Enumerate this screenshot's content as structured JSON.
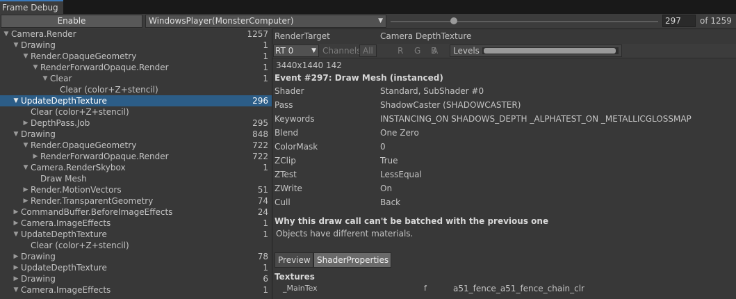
{
  "window": {
    "tab_title": "Frame Debug"
  },
  "toolbar": {
    "enable_label": "Enable",
    "player": "WindowsPlayer(MonsterComputer)",
    "event_index": "297",
    "event_total": "of 1259",
    "slider_fraction": 0.236
  },
  "tree": {
    "rows": [
      {
        "label": "Camera.Render",
        "count": "1257",
        "arrow": "▼",
        "indent": 0
      },
      {
        "label": "Drawing",
        "count": "1",
        "arrow": "▼",
        "indent": 1
      },
      {
        "label": "Render.OpaqueGeometry",
        "count": "1",
        "arrow": "▼",
        "indent": 2
      },
      {
        "label": "RenderForwardOpaque.Render",
        "count": "1",
        "arrow": "▼",
        "indent": 3
      },
      {
        "label": "Clear",
        "count": "1",
        "arrow": "▼",
        "indent": 4
      },
      {
        "label": "Clear (color+Z+stencil)",
        "count": "",
        "arrow": "",
        "indent": 5
      },
      {
        "label": "UpdateDepthTexture",
        "count": "296",
        "arrow": "▼",
        "indent": 1,
        "selected": true
      },
      {
        "label": "Clear (color+Z+stencil)",
        "count": "",
        "arrow": "",
        "indent": 2
      },
      {
        "label": "DepthPass.Job",
        "count": "295",
        "arrow": "▶",
        "indent": 2
      },
      {
        "label": "Drawing",
        "count": "848",
        "arrow": "▼",
        "indent": 1
      },
      {
        "label": "Render.OpaqueGeometry",
        "count": "722",
        "arrow": "▼",
        "indent": 2
      },
      {
        "label": "RenderForwardOpaque.Render",
        "count": "722",
        "arrow": "▶",
        "indent": 3
      },
      {
        "label": "Camera.RenderSkybox",
        "count": "1",
        "arrow": "▼",
        "indent": 2
      },
      {
        "label": "Draw Mesh",
        "count": "",
        "arrow": "",
        "indent": 3
      },
      {
        "label": "Render.MotionVectors",
        "count": "51",
        "arrow": "▶",
        "indent": 2
      },
      {
        "label": "Render.TransparentGeometry",
        "count": "74",
        "arrow": "▶",
        "indent": 2
      },
      {
        "label": "CommandBuffer.BeforeImageEffects",
        "count": "24",
        "arrow": "▶",
        "indent": 1
      },
      {
        "label": "Camera.ImageEffects",
        "count": "1",
        "arrow": "▶",
        "indent": 1
      },
      {
        "label": "UpdateDepthTexture",
        "count": "1",
        "arrow": "▼",
        "indent": 1
      },
      {
        "label": "Clear (color+Z+stencil)",
        "count": "",
        "arrow": "",
        "indent": 2
      },
      {
        "label": "Drawing",
        "count": "78",
        "arrow": "▶",
        "indent": 1
      },
      {
        "label": "UpdateDepthTexture",
        "count": "1",
        "arrow": "▶",
        "indent": 1
      },
      {
        "label": "Drawing",
        "count": "6",
        "arrow": "▶",
        "indent": 1
      },
      {
        "label": "Camera.ImageEffects",
        "count": "1",
        "arrow": "▼",
        "indent": 1
      }
    ]
  },
  "detail": {
    "render_target_label": "RenderTarget",
    "render_target_value": "Camera DepthTexture",
    "rt_select": "RT 0",
    "channels_label": "Channels",
    "channels": [
      "All",
      "R",
      "G",
      "B",
      "A"
    ],
    "levels_label": "Levels",
    "dimensions": "3440x1440 142",
    "event_title": "Event #297: Draw Mesh (instanced)",
    "props": [
      {
        "key": "Shader",
        "value": "Standard, SubShader #0"
      },
      {
        "key": "Pass",
        "value": "ShadowCaster (SHADOWCASTER)"
      },
      {
        "key": "Keywords",
        "value": "INSTANCING_ON SHADOWS_DEPTH _ALPHATEST_ON _METALLICGLOSSMAP"
      },
      {
        "key": "Blend",
        "value": "One Zero"
      },
      {
        "key": "ColorMask",
        "value": "0"
      },
      {
        "key": "ZClip",
        "value": "True"
      },
      {
        "key": "ZTest",
        "value": "LessEqual"
      },
      {
        "key": "ZWrite",
        "value": "On"
      },
      {
        "key": "Cull",
        "value": "Back"
      }
    ],
    "batch_title": "Why this draw call can't be batched with the previous one",
    "batch_reason": "Objects have different materials.",
    "tabs": [
      "Preview",
      "ShaderProperties"
    ],
    "textures_title": "Textures",
    "texture": {
      "name": "_MainTex",
      "stage": "f",
      "value": "a51_fence_a51_fence_chain_clr"
    }
  },
  "colors": {
    "selection": "#2c5d87",
    "accent_tab": "#3a79bb"
  }
}
